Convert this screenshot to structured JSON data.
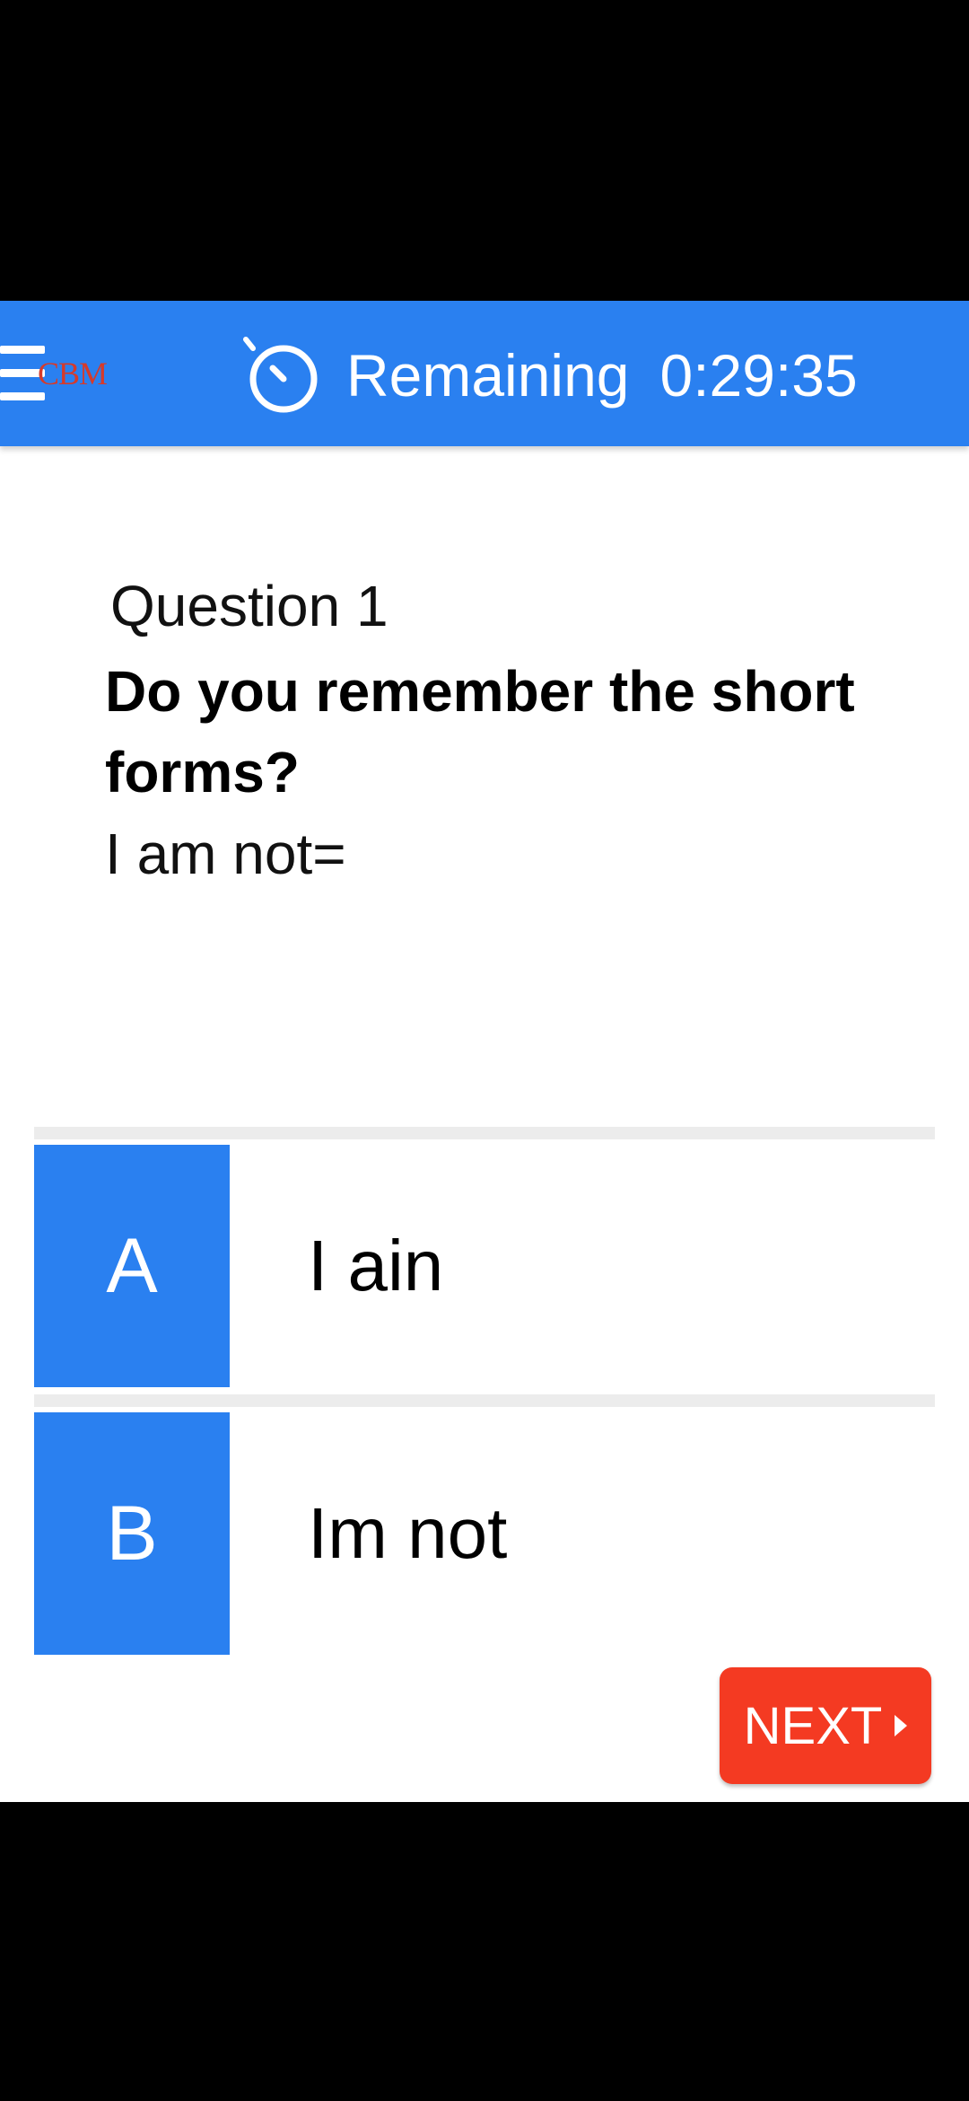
{
  "header": {
    "logo_text": "CBM",
    "timer_label": "Remaining",
    "timer_value": "0:29:35"
  },
  "question": {
    "number_label": "Question 1",
    "title": "Do you remember the short forms?",
    "prompt": "I am not="
  },
  "options": [
    {
      "letter": "A",
      "text": "I ain"
    },
    {
      "letter": "B",
      "text": "Im not"
    }
  ],
  "actions": {
    "next_label": "NEXT"
  },
  "colors": {
    "accent": "#2a80f0",
    "next_button": "#f43a22",
    "logo": "#d63a2a"
  },
  "icons": [
    "menu-icon",
    "stopwatch-icon",
    "next-arrow-icon"
  ]
}
